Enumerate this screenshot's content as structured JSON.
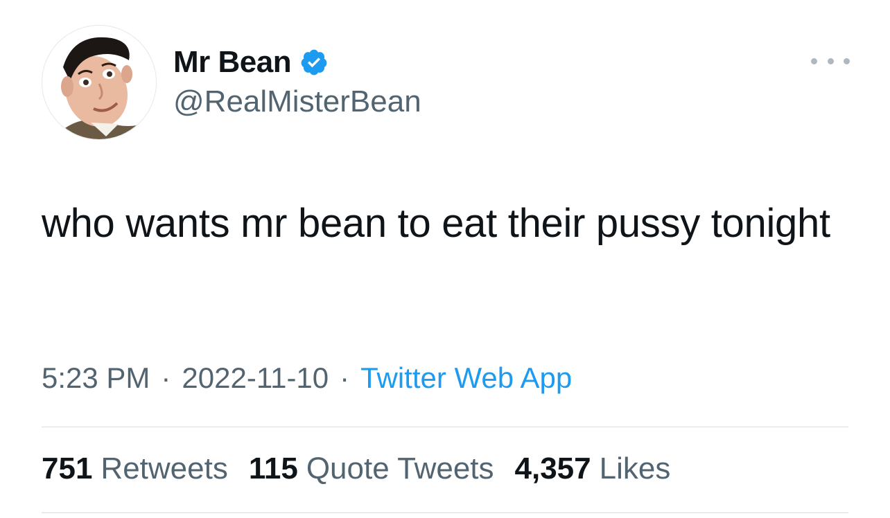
{
  "author": {
    "display_name": "Mr Bean",
    "handle": "@RealMisterBean",
    "verified": true,
    "avatar_icon": "profile-photo"
  },
  "tweet": {
    "text": "who wants mr bean to eat their pussy tonight"
  },
  "meta": {
    "time": "5:23 PM",
    "date": "2022-11-10",
    "separator": "·",
    "source": "Twitter Web App"
  },
  "stats": {
    "retweets_count": "751",
    "retweets_label": "Retweets",
    "quotes_count": "115",
    "quotes_label": "Quote Tweets",
    "likes_count": "4,357",
    "likes_label": "Likes"
  },
  "colors": {
    "text_primary": "#0f1419",
    "text_secondary": "#536471",
    "accent": "#1d9bf0",
    "divider": "#d9dde1"
  }
}
